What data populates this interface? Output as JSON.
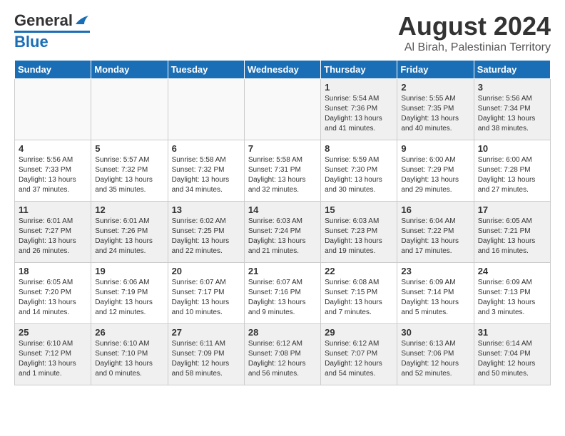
{
  "header": {
    "logo_general": "General",
    "logo_blue": "Blue",
    "title": "August 2024",
    "subtitle": "Al Birah, Palestinian Territory"
  },
  "days_of_week": [
    "Sunday",
    "Monday",
    "Tuesday",
    "Wednesday",
    "Thursday",
    "Friday",
    "Saturday"
  ],
  "weeks": [
    [
      {
        "day": "",
        "info": "",
        "empty": true
      },
      {
        "day": "",
        "info": "",
        "empty": true
      },
      {
        "day": "",
        "info": "",
        "empty": true
      },
      {
        "day": "",
        "info": "",
        "empty": true
      },
      {
        "day": "1",
        "info": "Sunrise: 5:54 AM\nSunset: 7:36 PM\nDaylight: 13 hours\nand 41 minutes."
      },
      {
        "day": "2",
        "info": "Sunrise: 5:55 AM\nSunset: 7:35 PM\nDaylight: 13 hours\nand 40 minutes."
      },
      {
        "day": "3",
        "info": "Sunrise: 5:56 AM\nSunset: 7:34 PM\nDaylight: 13 hours\nand 38 minutes."
      }
    ],
    [
      {
        "day": "4",
        "info": "Sunrise: 5:56 AM\nSunset: 7:33 PM\nDaylight: 13 hours\nand 37 minutes."
      },
      {
        "day": "5",
        "info": "Sunrise: 5:57 AM\nSunset: 7:32 PM\nDaylight: 13 hours\nand 35 minutes."
      },
      {
        "day": "6",
        "info": "Sunrise: 5:58 AM\nSunset: 7:32 PM\nDaylight: 13 hours\nand 34 minutes."
      },
      {
        "day": "7",
        "info": "Sunrise: 5:58 AM\nSunset: 7:31 PM\nDaylight: 13 hours\nand 32 minutes."
      },
      {
        "day": "8",
        "info": "Sunrise: 5:59 AM\nSunset: 7:30 PM\nDaylight: 13 hours\nand 30 minutes."
      },
      {
        "day": "9",
        "info": "Sunrise: 6:00 AM\nSunset: 7:29 PM\nDaylight: 13 hours\nand 29 minutes."
      },
      {
        "day": "10",
        "info": "Sunrise: 6:00 AM\nSunset: 7:28 PM\nDaylight: 13 hours\nand 27 minutes."
      }
    ],
    [
      {
        "day": "11",
        "info": "Sunrise: 6:01 AM\nSunset: 7:27 PM\nDaylight: 13 hours\nand 26 minutes."
      },
      {
        "day": "12",
        "info": "Sunrise: 6:01 AM\nSunset: 7:26 PM\nDaylight: 13 hours\nand 24 minutes."
      },
      {
        "day": "13",
        "info": "Sunrise: 6:02 AM\nSunset: 7:25 PM\nDaylight: 13 hours\nand 22 minutes."
      },
      {
        "day": "14",
        "info": "Sunrise: 6:03 AM\nSunset: 7:24 PM\nDaylight: 13 hours\nand 21 minutes."
      },
      {
        "day": "15",
        "info": "Sunrise: 6:03 AM\nSunset: 7:23 PM\nDaylight: 13 hours\nand 19 minutes."
      },
      {
        "day": "16",
        "info": "Sunrise: 6:04 AM\nSunset: 7:22 PM\nDaylight: 13 hours\nand 17 minutes."
      },
      {
        "day": "17",
        "info": "Sunrise: 6:05 AM\nSunset: 7:21 PM\nDaylight: 13 hours\nand 16 minutes."
      }
    ],
    [
      {
        "day": "18",
        "info": "Sunrise: 6:05 AM\nSunset: 7:20 PM\nDaylight: 13 hours\nand 14 minutes."
      },
      {
        "day": "19",
        "info": "Sunrise: 6:06 AM\nSunset: 7:19 PM\nDaylight: 13 hours\nand 12 minutes."
      },
      {
        "day": "20",
        "info": "Sunrise: 6:07 AM\nSunset: 7:17 PM\nDaylight: 13 hours\nand 10 minutes."
      },
      {
        "day": "21",
        "info": "Sunrise: 6:07 AM\nSunset: 7:16 PM\nDaylight: 13 hours\nand 9 minutes."
      },
      {
        "day": "22",
        "info": "Sunrise: 6:08 AM\nSunset: 7:15 PM\nDaylight: 13 hours\nand 7 minutes."
      },
      {
        "day": "23",
        "info": "Sunrise: 6:09 AM\nSunset: 7:14 PM\nDaylight: 13 hours\nand 5 minutes."
      },
      {
        "day": "24",
        "info": "Sunrise: 6:09 AM\nSunset: 7:13 PM\nDaylight: 13 hours\nand 3 minutes."
      }
    ],
    [
      {
        "day": "25",
        "info": "Sunrise: 6:10 AM\nSunset: 7:12 PM\nDaylight: 13 hours\nand 1 minute."
      },
      {
        "day": "26",
        "info": "Sunrise: 6:10 AM\nSunset: 7:10 PM\nDaylight: 13 hours\nand 0 minutes."
      },
      {
        "day": "27",
        "info": "Sunrise: 6:11 AM\nSunset: 7:09 PM\nDaylight: 12 hours\nand 58 minutes."
      },
      {
        "day": "28",
        "info": "Sunrise: 6:12 AM\nSunset: 7:08 PM\nDaylight: 12 hours\nand 56 minutes."
      },
      {
        "day": "29",
        "info": "Sunrise: 6:12 AM\nSunset: 7:07 PM\nDaylight: 12 hours\nand 54 minutes."
      },
      {
        "day": "30",
        "info": "Sunrise: 6:13 AM\nSunset: 7:06 PM\nDaylight: 12 hours\nand 52 minutes."
      },
      {
        "day": "31",
        "info": "Sunrise: 6:14 AM\nSunset: 7:04 PM\nDaylight: 12 hours\nand 50 minutes."
      }
    ]
  ]
}
